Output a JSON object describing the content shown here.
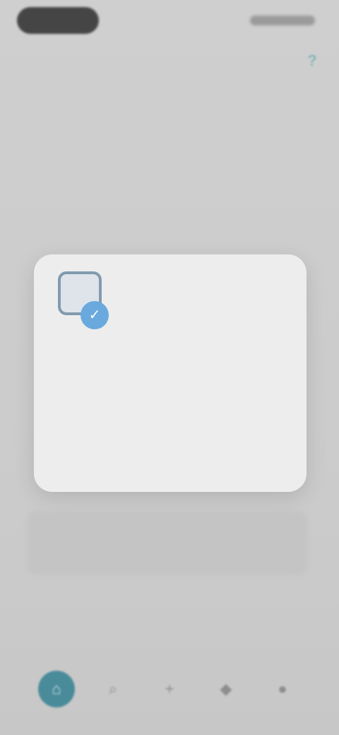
{
  "status_bar": {
    "left_indicator": "",
    "right_indicators": ""
  },
  "header": {
    "help_icon": "help-icon"
  },
  "dialog": {
    "heading": "",
    "title": "",
    "body": "",
    "link": "",
    "secondary_button": "",
    "primary_button": ""
  },
  "bottom_nav": {
    "items": [
      {
        "icon": "home-icon",
        "active": true
      },
      {
        "icon": "search-icon",
        "active": false
      },
      {
        "icon": "add-icon",
        "active": false
      },
      {
        "icon": "bell-icon",
        "active": false
      },
      {
        "icon": "profile-icon",
        "active": false
      }
    ]
  },
  "colors": {
    "accent": "#4aa9b2",
    "nav_active": "#4a8b9a",
    "dialog_bg": "#ededed",
    "screen_bg": "#d0d0d0"
  }
}
